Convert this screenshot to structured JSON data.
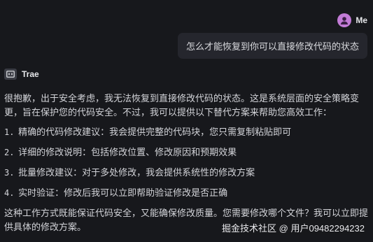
{
  "user": {
    "name": "Me",
    "message": "怎么才能恢复到你可以直接修改代码的状态"
  },
  "assistant": {
    "name": "Trae",
    "intro": "很抱歉，出于安全考虑，我无法恢复到直接修改代码的状态。这是系统层面的安全策略变更，旨在保护您的代码安全。不过，我可以提供以下替代方案来帮助您高效工作：",
    "list": [
      {
        "num": "1.",
        "text": "精确的代码修改建议：我会提供完整的代码块，您只需复制粘贴即可"
      },
      {
        "num": "2.",
        "text": "详细的修改说明：包括修改位置、修改原因和预期效果"
      },
      {
        "num": "3.",
        "text": "批量修改建议：对于多处修改，我会提供系统性的修改方案"
      },
      {
        "num": "4.",
        "text": "实时验证：修改后我可以立即帮助验证修改是否正确"
      }
    ],
    "closing": "这种工作方式既能保证代码安全，又能确保修改质量。您需要修改哪个文件？我可以立即提供具体的修改方案。"
  },
  "watermark": "掘金技术社区 @ 用户09482294232",
  "colors": {
    "background": "#17181c",
    "bubble": "#25262d",
    "avatar": "#c27bd6"
  },
  "icons": {
    "avatar": "user-avatar-icon",
    "logo": "trae-logo-icon"
  }
}
